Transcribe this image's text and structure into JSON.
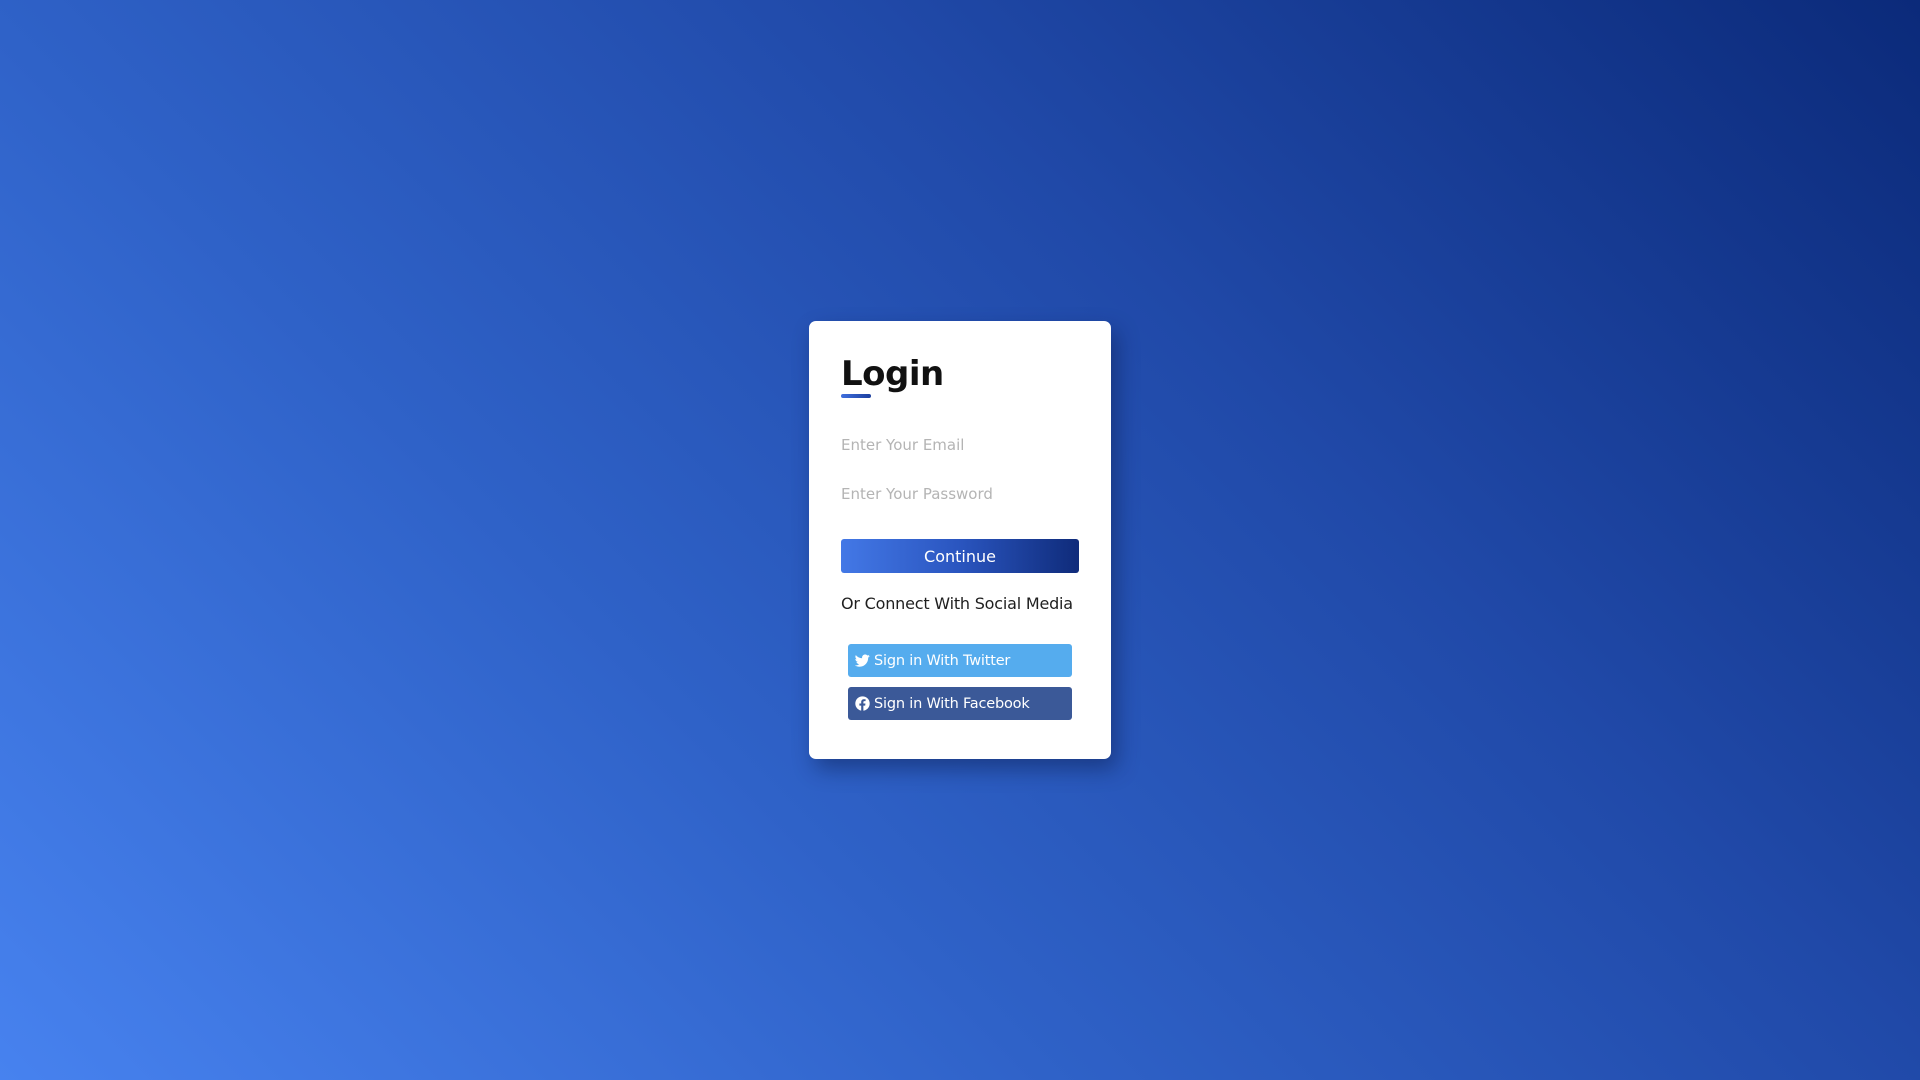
{
  "login": {
    "title": "Login",
    "email_placeholder": "Enter Your Email",
    "password_placeholder": "Enter Your Password",
    "continue_label": "Continue",
    "social_text": "Or Connect With Social Media",
    "social_buttons": [
      {
        "label": "Sign in With Twitter",
        "icon": "twitter-icon",
        "color": "#55acee"
      },
      {
        "label": "Sign in With Facebook",
        "icon": "facebook-icon",
        "color": "#3b5998"
      }
    ]
  },
  "colors": {
    "background_start": "#4782ef",
    "background_end": "#0b2a7a",
    "card": "#ffffff",
    "continue_start": "#4378e6",
    "continue_end": "#0f2b7a"
  }
}
